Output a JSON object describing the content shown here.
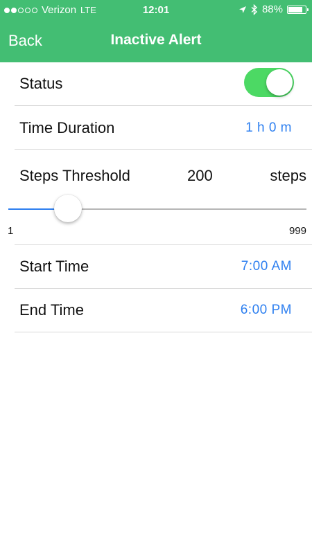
{
  "status_bar": {
    "signal_dots_filled": 2,
    "signal_dots_total": 5,
    "carrier": "Verizon",
    "network": "LTE",
    "time": "12:01",
    "battery_percent": "88%",
    "battery_level": 0.88,
    "icons": [
      "location-arrow-icon",
      "bluetooth-icon",
      "battery-icon"
    ]
  },
  "nav": {
    "back_label": "Back",
    "title": "Inactive Alert"
  },
  "settings": {
    "status_label": "Status",
    "status_on": true,
    "duration_label": "Time Duration",
    "duration_value": "1 h 0 m",
    "steps_label": "Steps Threshold",
    "steps_value": "200",
    "steps_unit": "steps",
    "slider_min": "1",
    "slider_max": "999",
    "slider_value": 200,
    "start_label": "Start Time",
    "start_value": "7:00 AM",
    "end_label": "End Time",
    "end_value": "6:00 PM"
  },
  "colors": {
    "header_bg": "#43be73",
    "accent_blue": "#2d7ff0",
    "toggle_on": "#4cd964"
  }
}
